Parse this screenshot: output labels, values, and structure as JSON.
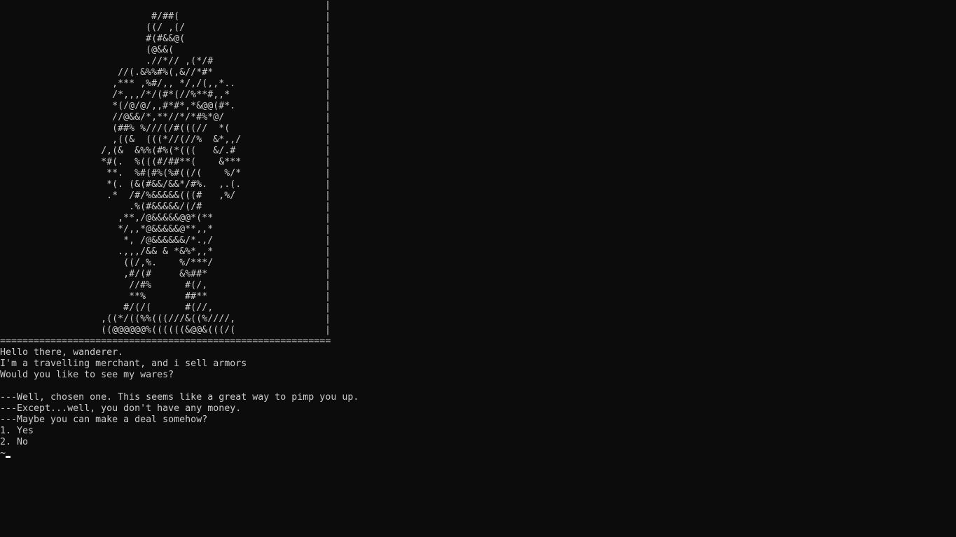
{
  "art_rows": [
    "",
    "                           #/##(",
    "                          ((/ ,(/",
    "                          #(#&&@(",
    "                          (@&&(",
    "                          .//*// ,(*/#",
    "                     //(.&%%#%(,&//*#*",
    "                    ,*** ,%#/,, */,/(,,*..",
    "                    /*,,,/*/(#*(//%**#,,*",
    "                    *(/@/@/,,#*#*,*&@@(#*.",
    "                    //@&&/*,**//*/*#%*@/",
    "                    (##% %///(/#(((//  *(",
    "                    ,((&  (((*//(//%  &*,,/",
    "                  /,(&  &%%(#%(*(((   &/.#",
    "                  *#(.  %(((#/##**(    &***",
    "                   **.  %#(#%(%#((/(    %/*",
    "                   *(. (&(#&&/&&*/#%.  ,.(.",
    "                   .*  /#/%&&&&&(((#   ,%/",
    "                       .%(#&&&&&/(/#",
    "                     ,**,/@&&&&&@@*(**",
    "                     */,,*@&&&&&@**,,*",
    "                      *, /@&&&&&&/*.,/",
    "                     .,,,/&& & *&%*,,*",
    "                      ((/,%.    %/***/",
    "                      ,#/(#     &%##*",
    "                       //#%      #(/,",
    "                       **%       ##**",
    "                      #/(/(      #(//,",
    "                  ,((*/((%%(((///&((%////,",
    "                  ((@@@@@@%((((((&@@&(((/("
  ],
  "frame_char": "|",
  "separator": "===========================================================",
  "output_lines": [
    "Hello there, wanderer.",
    "I'm a travelling merchant, and i sell armors",
    "Would you like to see my wares?",
    "",
    "---Well, chosen one. This seems like a great way to pimp you up.",
    "---Except...well, you don't have any money.",
    "---Maybe you can make a deal somehow?"
  ],
  "options": [
    "1. Yes",
    "2. No"
  ],
  "prompt_symbol": "~",
  "colors": {
    "background": "#0c0c0c",
    "text": "#cccccc",
    "cursor": "#f2f2f2"
  }
}
